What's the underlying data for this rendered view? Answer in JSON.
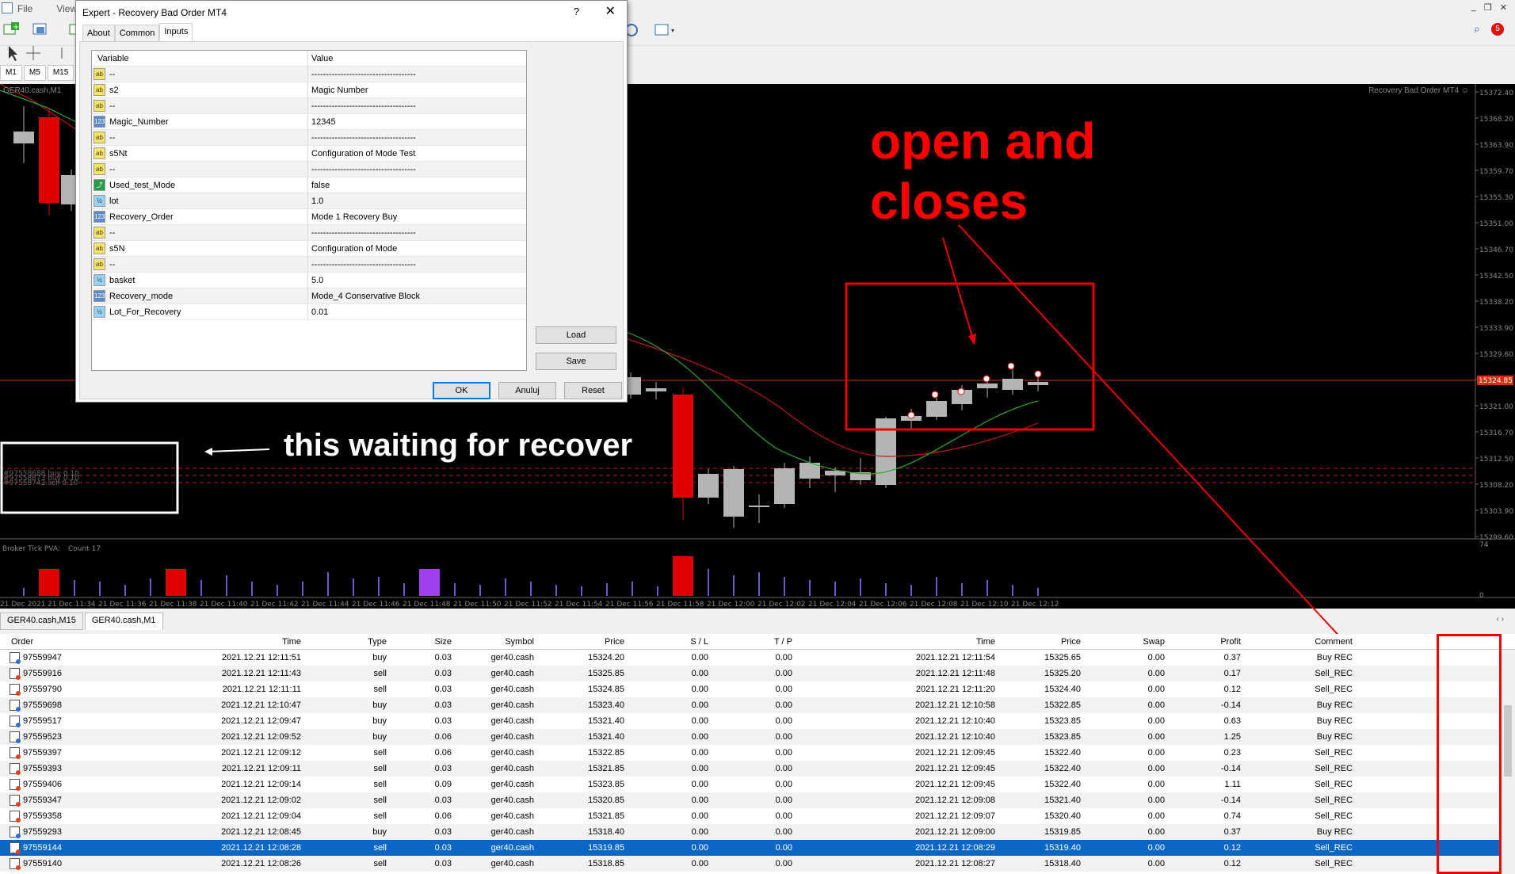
{
  "menu": {
    "items": [
      "File",
      "View"
    ]
  },
  "timeframes": [
    "M1",
    "M5",
    "M15",
    "M"
  ],
  "notifications": {
    "count": "5"
  },
  "chart": {
    "symbol_label": "GER40.cash,M1",
    "ea_label": "Recovery Bad Order MT4 ☺",
    "price_labels": [
      "15372.40",
      "15368.20",
      "15363.90",
      "15359.70",
      "15355.30",
      "15351.00",
      "15346.70",
      "15342.50",
      "15338.20",
      "15333.90",
      "15329.60",
      "15325.30",
      "15321.00",
      "15316.70",
      "15312.50",
      "15308.20",
      "15303.90",
      "15299.60"
    ],
    "current_price": "15324.85",
    "marker_price": "15326.15",
    "indicator_label": "Broker Tick PVA:",
    "indicator_count": "Count  17",
    "indicator_scale_top": "74",
    "indicator_scale_bottom": "0",
    "time_labels": [
      "21 Dec 2021",
      "21 Dec 11:34",
      "21 Dec 11:36",
      "21 Dec 11:38",
      "21 Dec 11:40",
      "21 Dec 11:42",
      "21 Dec 11:44",
      "21 Dec 11:46",
      "21 Dec 11:48",
      "21 Dec 11:50",
      "21 Dec 11:52",
      "21 Dec 11:54",
      "21 Dec 11:56",
      "21 Dec 11:58",
      "21 Dec 12:00",
      "21 Dec 12:02",
      "21 Dec 12:04",
      "21 Dec 12:06",
      "21 Dec 12:08",
      "21 Dec 12:10",
      "21 Dec 12:12"
    ],
    "order_lines": [
      "#97558688 buy 0.10",
      "#97558873 buy 0.10",
      "#97558742 sell 0.10"
    ],
    "colors": {
      "bull": "#b4b4b4",
      "bear": "#e00000",
      "ma_fast": "#2ea82e",
      "ma_slow": "#c01818",
      "price_line": "#d03010"
    }
  },
  "annotations": {
    "open_closes_line1": "open and",
    "open_closes_line2": "closes",
    "waiting": "this waiting for recover"
  },
  "dialog": {
    "title": "Expert - Recovery Bad Order MT4",
    "help": "?",
    "close": "✕",
    "tabs": [
      "About",
      "Common",
      "Inputs"
    ],
    "col_variable": "Variable",
    "col_value": "Value",
    "params": [
      {
        "icon": "str",
        "name": "--",
        "value": "------------------------------------"
      },
      {
        "icon": "str",
        "name": "s2",
        "value": "Magic Number"
      },
      {
        "icon": "str",
        "name": "--",
        "value": "------------------------------------"
      },
      {
        "icon": "int",
        "name": "Magic_Number",
        "value": "12345"
      },
      {
        "icon": "str",
        "name": "--",
        "value": "------------------------------------"
      },
      {
        "icon": "str",
        "name": "s5Nt",
        "value": "Configuration of Mode Test"
      },
      {
        "icon": "str",
        "name": "--",
        "value": "------------------------------------"
      },
      {
        "icon": "bool",
        "name": "Used_test_Mode",
        "value": "false"
      },
      {
        "icon": "dbl",
        "name": "lot",
        "value": "1.0"
      },
      {
        "icon": "int",
        "name": "Recovery_Order",
        "value": "Mode 1 Recovery Buy"
      },
      {
        "icon": "str",
        "name": "--",
        "value": "------------------------------------"
      },
      {
        "icon": "str",
        "name": "s5N",
        "value": "Configuration of Mode"
      },
      {
        "icon": "str",
        "name": "--",
        "value": "------------------------------------"
      },
      {
        "icon": "dbl",
        "name": "basket",
        "value": "5.0"
      },
      {
        "icon": "int",
        "name": "Recovery_mode",
        "value": "Mode_4 Conservative Block"
      },
      {
        "icon": "dbl",
        "name": "Lot_For_Recovery",
        "value": "0.01"
      }
    ],
    "icon_text": {
      "str": "ab",
      "int": "123",
      "bool": "⤴",
      "dbl": "½"
    },
    "load": "Load",
    "save": "Save",
    "ok": "OK",
    "cancel": "Anuluj",
    "reset": "Reset"
  },
  "chart_tabs": [
    "GER40.cash,M15",
    "GER40.cash,M1"
  ],
  "orders": {
    "headers": [
      "Order",
      "Time",
      "Type",
      "Size",
      "Symbol",
      "Price",
      "S / L",
      "T / P",
      "Time",
      "Price",
      "Swap",
      "Profit",
      "Comment"
    ],
    "rows": [
      [
        "97559947",
        "2021.12.21 12:11:51",
        "buy",
        "0.03",
        "ger40.cash",
        "15324.20",
        "0.00",
        "0.00",
        "2021.12.21 12:11:54",
        "15325.65",
        "0.00",
        "0.37",
        "Buy REC"
      ],
      [
        "97559916",
        "2021.12.21 12:11:43",
        "sell",
        "0.03",
        "ger40.cash",
        "15325.85",
        "0.00",
        "0.00",
        "2021.12.21 12:11:48",
        "15325.20",
        "0.00",
        "0.17",
        "Sell_REC"
      ],
      [
        "97559790",
        "2021.12.21 12:11:11",
        "sell",
        "0.03",
        "ger40.cash",
        "15324.85",
        "0.00",
        "0.00",
        "2021.12.21 12:11:20",
        "15324.40",
        "0.00",
        "0.12",
        "Sell_REC"
      ],
      [
        "97559698",
        "2021.12.21 12:10:47",
        "buy",
        "0.03",
        "ger40.cash",
        "15323.40",
        "0.00",
        "0.00",
        "2021.12.21 12:10:58",
        "15322.85",
        "0.00",
        "-0.14",
        "Buy REC"
      ],
      [
        "97559517",
        "2021.12.21 12:09:47",
        "buy",
        "0.03",
        "ger40.cash",
        "15321.40",
        "0.00",
        "0.00",
        "2021.12.21 12:10:40",
        "15323.85",
        "0.00",
        "0.63",
        "Buy REC"
      ],
      [
        "97559523",
        "2021.12.21 12:09:52",
        "buy",
        "0.06",
        "ger40.cash",
        "15321.40",
        "0.00",
        "0.00",
        "2021.12.21 12:10:40",
        "15323.85",
        "0.00",
        "1.25",
        "Buy REC"
      ],
      [
        "97559397",
        "2021.12.21 12:09:12",
        "sell",
        "0.06",
        "ger40.cash",
        "15322.85",
        "0.00",
        "0.00",
        "2021.12.21 12:09:45",
        "15322.40",
        "0.00",
        "0.23",
        "Sell_REC"
      ],
      [
        "97559393",
        "2021.12.21 12:09:11",
        "sell",
        "0.03",
        "ger40.cash",
        "15321.85",
        "0.00",
        "0.00",
        "2021.12.21 12:09:45",
        "15322.40",
        "0.00",
        "-0.14",
        "Sell_REC"
      ],
      [
        "97559406",
        "2021.12.21 12:09:14",
        "sell",
        "0.09",
        "ger40.cash",
        "15323.85",
        "0.00",
        "0.00",
        "2021.12.21 12:09:45",
        "15322.40",
        "0.00",
        "1.11",
        "Sell_REC"
      ],
      [
        "97559347",
        "2021.12.21 12:09:02",
        "sell",
        "0.03",
        "ger40.cash",
        "15320.85",
        "0.00",
        "0.00",
        "2021.12.21 12:09:08",
        "15321.40",
        "0.00",
        "-0.14",
        "Sell_REC"
      ],
      [
        "97559358",
        "2021.12.21 12:09:04",
        "sell",
        "0.06",
        "ger40.cash",
        "15321.85",
        "0.00",
        "0.00",
        "2021.12.21 12:09:07",
        "15320.40",
        "0.00",
        "0.74",
        "Sell_REC"
      ],
      [
        "97559293",
        "2021.12.21 12:08:45",
        "buy",
        "0.03",
        "ger40.cash",
        "15318.40",
        "0.00",
        "0.00",
        "2021.12.21 12:09:00",
        "15319.85",
        "0.00",
        "0.37",
        "Buy REC"
      ],
      [
        "97559144",
        "2021.12.21 12:08:28",
        "sell",
        "0.03",
        "ger40.cash",
        "15319.85",
        "0.00",
        "0.00",
        "2021.12.21 12:08:29",
        "15319.40",
        "0.00",
        "0.12",
        "Sell_REC"
      ],
      [
        "97559140",
        "2021.12.21 12:08:26",
        "sell",
        "0.03",
        "ger40.cash",
        "15318.85",
        "0.00",
        "0.00",
        "2021.12.21 12:08:27",
        "15318.40",
        "0.00",
        "0.12",
        "Sell_REC"
      ]
    ],
    "selected_index": 12
  }
}
